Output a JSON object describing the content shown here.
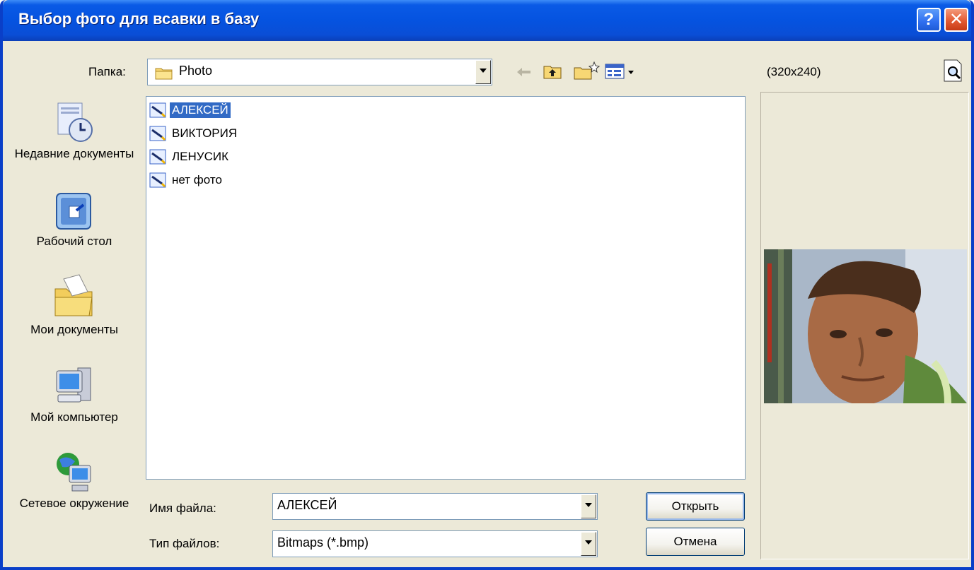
{
  "window": {
    "title": "Выбор фото для всавки в базу"
  },
  "titlebar_buttons": {
    "help": "?",
    "close": "✕"
  },
  "folder": {
    "label": "Папка:",
    "value": "Photo"
  },
  "preview": {
    "resolution": "(320x240)"
  },
  "places": [
    {
      "label": "Недавние документы",
      "icon": "recent-documents-icon"
    },
    {
      "label": "Рабочий стол",
      "icon": "desktop-icon"
    },
    {
      "label": "Мои документы",
      "icon": "my-documents-icon"
    },
    {
      "label": "Мой компьютер",
      "icon": "my-computer-icon"
    },
    {
      "label": "Сетевое окружение",
      "icon": "network-icon"
    }
  ],
  "files": [
    {
      "name": "АЛЕКСЕЙ",
      "selected": true
    },
    {
      "name": "ВИКТОРИЯ",
      "selected": false
    },
    {
      "name": "ЛЕНУСИК",
      "selected": false
    },
    {
      "name": "нет фото",
      "selected": false
    }
  ],
  "filename": {
    "label": "Имя файла:",
    "value": "АЛЕКСЕЙ"
  },
  "filetype": {
    "label": "Тип файлов:",
    "value": "Bitmaps (*.bmp)"
  },
  "buttons": {
    "open": "Открыть",
    "cancel": "Отмена"
  },
  "colors": {
    "titlebar": "#0553e0",
    "selection": "#316ac5",
    "dialog_bg": "#ece9d8"
  }
}
